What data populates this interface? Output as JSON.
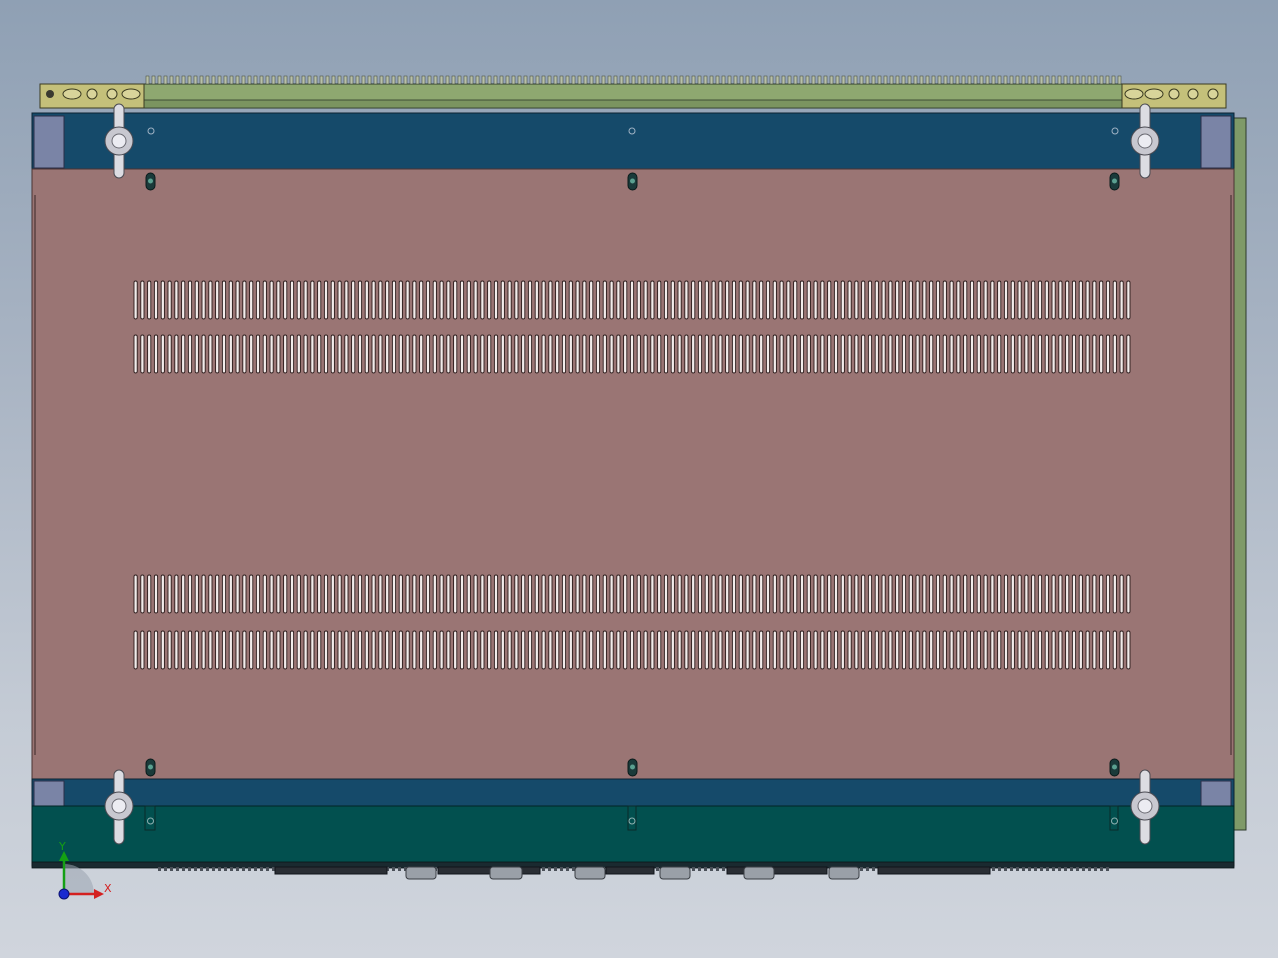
{
  "view": {
    "background_top": "#8fa0b4",
    "background_bottom": "#d0d5dd"
  },
  "model": {
    "panel_color": "#9a7574",
    "frame_blue": "#154a6a",
    "frame_teal": "#02504f",
    "rail_green": "#8ea870",
    "slot_rows": 4
  },
  "triad": {
    "x_label": "X",
    "y_label": "Y",
    "x_color": "#d42020",
    "y_color": "#14a014",
    "z_color": "#1a2ad0"
  }
}
